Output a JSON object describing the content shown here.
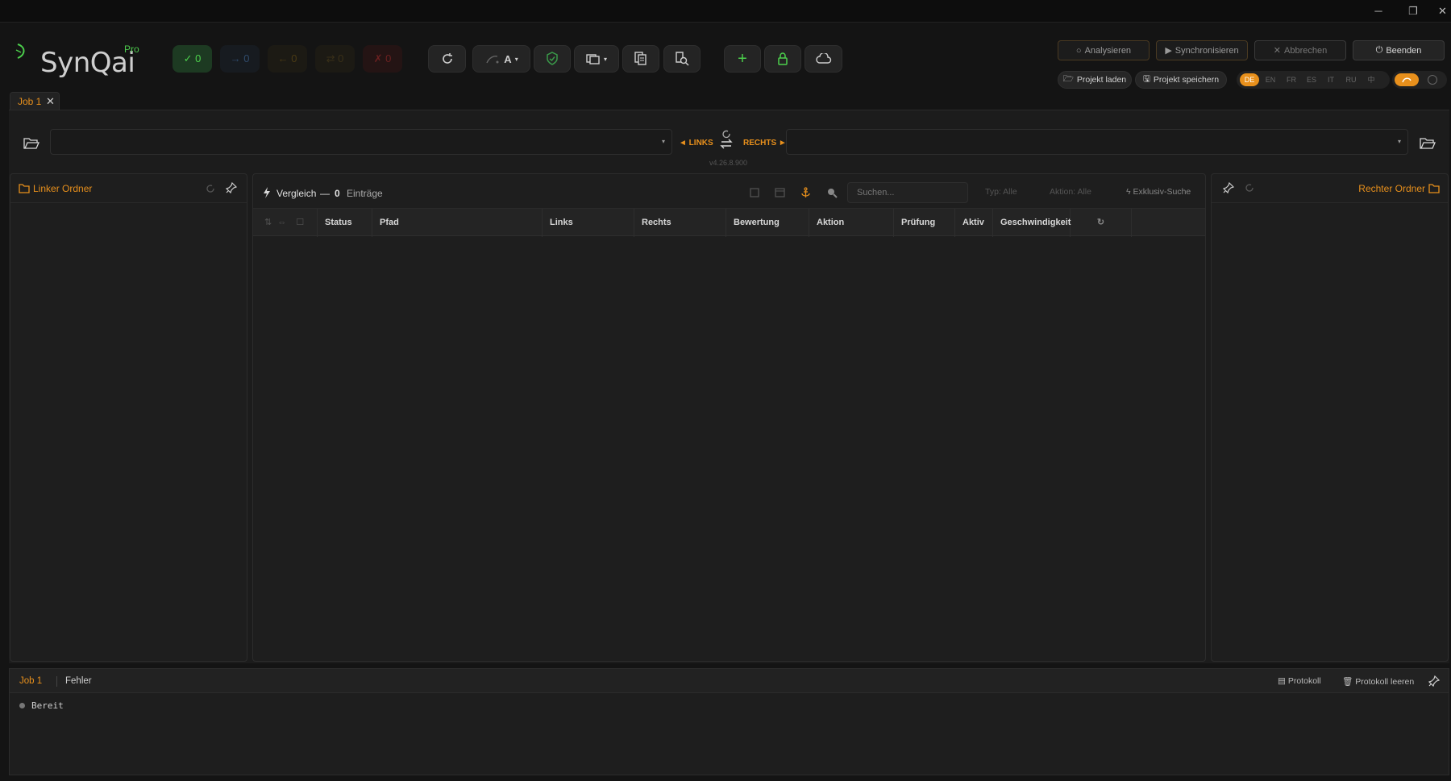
{
  "app": {
    "name": "SynQai",
    "edition": "Pro",
    "version": "v4.26.8.900"
  },
  "counters": [
    {
      "symbol": "✓",
      "value": "0",
      "color": "#4cd04c"
    },
    {
      "symbol": "→",
      "value": "0",
      "color": "#2f4a6a"
    },
    {
      "symbol": "←",
      "value": "0",
      "color": "#4a3a14"
    },
    {
      "symbol": "⇄",
      "value": "0",
      "color": "#3a3018"
    },
    {
      "symbol": "✗",
      "value": "0",
      "color": "#6a2020"
    }
  ],
  "toolbar": {
    "mode_label": "A"
  },
  "actions": {
    "analyze": "Analysieren",
    "sync": "Synchronisieren",
    "cancel": "Abbrechen",
    "quit": "Beenden",
    "load_project": "Projekt laden",
    "save_project": "Projekt speichern"
  },
  "languages": [
    "DE",
    "EN",
    "FR",
    "ES",
    "IT",
    "RU",
    "中"
  ],
  "active_language": "DE",
  "tabs": [
    {
      "label": "Job 1",
      "close": "✕"
    }
  ],
  "paths": {
    "left_label": "◄ LINKS",
    "right_label": "RECHTS ►",
    "left_value": "",
    "right_value": ""
  },
  "left_panel": {
    "title": "Linker Ordner"
  },
  "right_panel": {
    "title": "Rechter Ordner"
  },
  "compare": {
    "title": "Vergleich",
    "dash": "—",
    "count": "0",
    "entries_label": "Einträge",
    "search_placeholder": "Suchen...",
    "type_filter": "Typ: Alle",
    "action_filter": "Aktion: Alle",
    "exclusive_search": "Exklusiv-Suche",
    "columns": [
      "Status",
      "Pfad",
      "Links",
      "Rechts",
      "Bewertung",
      "Aktion",
      "Prüfung",
      "Aktiv",
      "Geschwindigkeit"
    ]
  },
  "bottom": {
    "tabs": [
      "Job 1",
      "Fehler"
    ],
    "protocol": "Protokoll",
    "clear_protocol": "Protokoll leeren",
    "log": [
      "Bereit"
    ]
  },
  "colors": {
    "accent": "#e8901c",
    "success": "#4cd04c",
    "background": "#141414"
  }
}
